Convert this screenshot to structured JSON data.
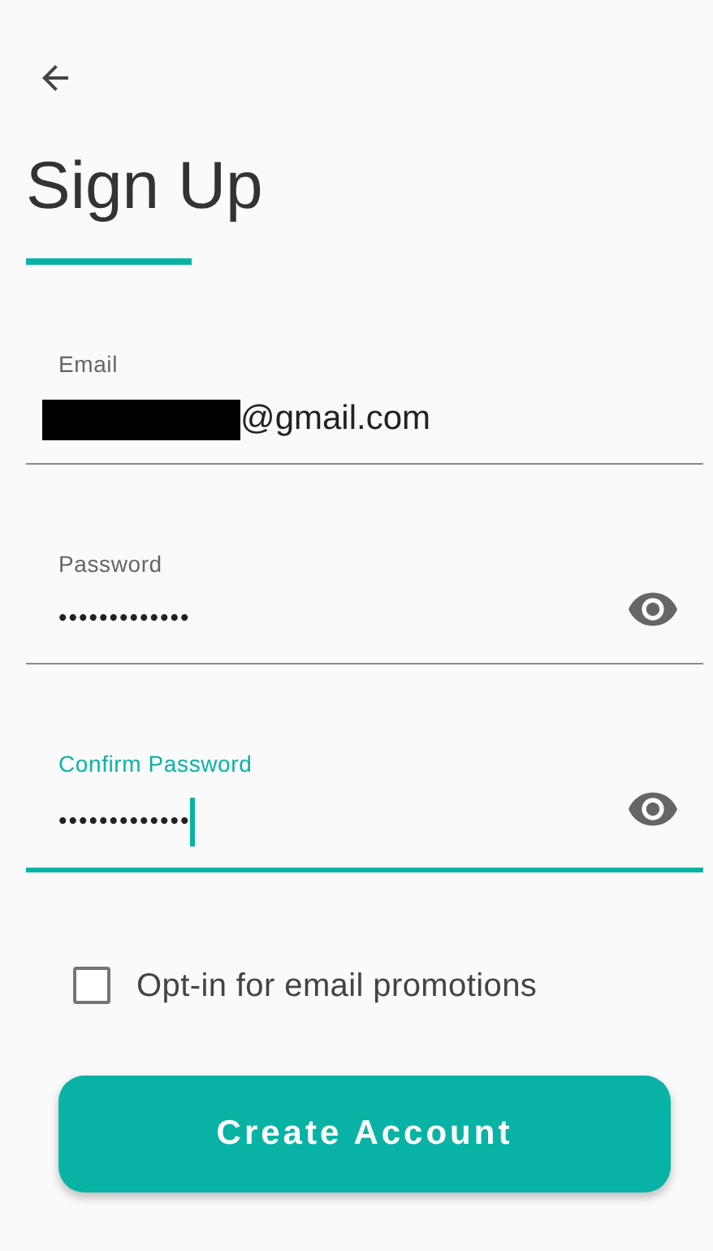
{
  "title": "Sign Up",
  "fields": [
    {
      "kind": "text",
      "label": "Email",
      "value": "@gmail.com",
      "redacted": true,
      "focused": false
    },
    {
      "kind": "password",
      "label": "Password",
      "value": "•••••••••••••",
      "redacted": false,
      "focused": false
    },
    {
      "kind": "password",
      "label": "Confirm Password",
      "value": "•••••••••••••",
      "redacted": false,
      "focused": true
    }
  ],
  "opt_in": {
    "label": "Opt-in for email promotions",
    "checked": false
  },
  "submit": {
    "label": "Create Account"
  }
}
